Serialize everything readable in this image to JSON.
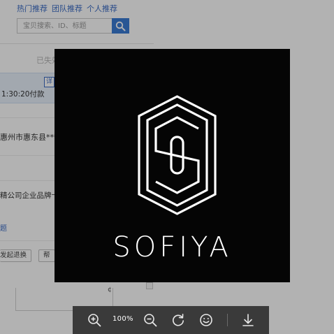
{
  "background_page": {
    "tabs": [
      "热门推荐",
      "团队推荐",
      "个人推荐"
    ],
    "search": {
      "placeholder": "宝贝搜索、ID、标题",
      "icon": "search-icon"
    },
    "faded_text": "已失效的",
    "order": {
      "detail_link": "详",
      "pay_time": "1:30:20付款",
      "address": "惠州市惠东县***",
      "brand_card": "精公司企业品牌卡",
      "topic_link": "题",
      "buttons": [
        "发起退换",
        "帮"
      ]
    },
    "mark": "¢"
  },
  "viewer": {
    "brand_name": "SOFIYA",
    "background": "#050505",
    "logo_color": "#ffffff"
  },
  "toolbar": {
    "zoom_in_icon": "zoom-in-icon",
    "zoom_level": "100%",
    "zoom_out_icon": "zoom-out-icon",
    "rotate_icon": "rotate-icon",
    "face_icon": "smiley-icon",
    "download_icon": "download-icon"
  }
}
